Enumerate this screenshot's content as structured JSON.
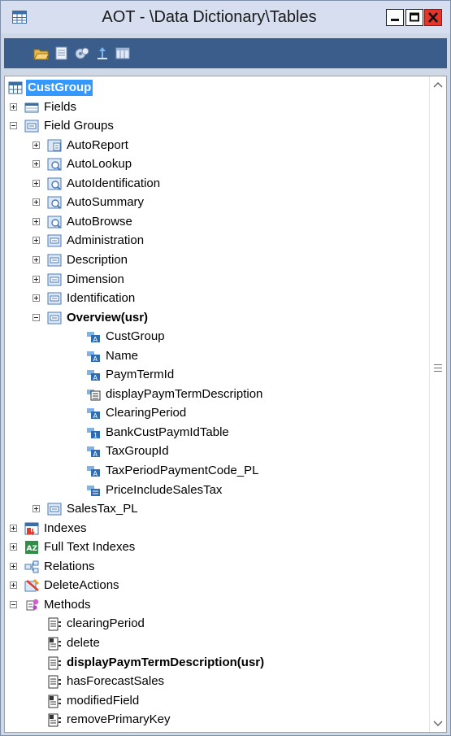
{
  "window": {
    "title": "AOT - \\Data Dictionary\\Tables",
    "icon": "table-grid-icon"
  },
  "toolbar": {
    "buttons": [
      {
        "icon": "open-folder-icon"
      },
      {
        "icon": "properties-icon"
      },
      {
        "icon": "compile-icon"
      },
      {
        "icon": "import-export-icon"
      },
      {
        "icon": "table-browser-icon"
      }
    ]
  },
  "tree": [
    {
      "label": "CustGroup",
      "icon": "table-icon",
      "level": 0,
      "expander": "none",
      "selected": true
    },
    {
      "label": "Fields",
      "icon": "fields-icon",
      "level": 1,
      "expander": "plus"
    },
    {
      "label": "Field Groups",
      "icon": "field-group-icon",
      "level": 1,
      "expander": "minus"
    },
    {
      "label": "AutoReport",
      "icon": "auto-report-icon",
      "level": 2,
      "expander": "plus"
    },
    {
      "label": "AutoLookup",
      "icon": "auto-group-icon",
      "level": 2,
      "expander": "plus"
    },
    {
      "label": "AutoIdentification",
      "icon": "auto-group-icon",
      "level": 2,
      "expander": "plus"
    },
    {
      "label": "AutoSummary",
      "icon": "auto-group-icon",
      "level": 2,
      "expander": "plus"
    },
    {
      "label": "AutoBrowse",
      "icon": "auto-group-icon",
      "level": 2,
      "expander": "plus"
    },
    {
      "label": "Administration",
      "icon": "field-group-icon",
      "level": 2,
      "expander": "plus"
    },
    {
      "label": "Description",
      "icon": "field-group-icon",
      "level": 2,
      "expander": "plus"
    },
    {
      "label": "Dimension",
      "icon": "field-group-icon",
      "level": 2,
      "expander": "plus"
    },
    {
      "label": "Identification",
      "icon": "field-group-icon",
      "level": 2,
      "expander": "plus"
    },
    {
      "label": "Overview(usr)",
      "icon": "field-group-icon",
      "level": 2,
      "expander": "minus",
      "bold": true
    },
    {
      "label": "CustGroup",
      "icon": "string-field-icon",
      "level": 3,
      "expander": "none"
    },
    {
      "label": "Name",
      "icon": "string-field-icon",
      "level": 3,
      "expander": "none"
    },
    {
      "label": "PaymTermId",
      "icon": "string-field-icon",
      "level": 3,
      "expander": "none"
    },
    {
      "label": "displayPaymTermDescription",
      "icon": "display-method-icon",
      "level": 3,
      "expander": "none"
    },
    {
      "label": "ClearingPeriod",
      "icon": "string-field-icon",
      "level": 3,
      "expander": "none"
    },
    {
      "label": "BankCustPaymIdTable",
      "icon": "int-field-icon",
      "level": 3,
      "expander": "none"
    },
    {
      "label": "TaxGroupId",
      "icon": "string-field-icon",
      "level": 3,
      "expander": "none"
    },
    {
      "label": "TaxPeriodPaymentCode_PL",
      "icon": "string-field-icon",
      "level": 3,
      "expander": "none"
    },
    {
      "label": "PriceIncludeSalesTax",
      "icon": "enum-field-icon",
      "level": 3,
      "expander": "none"
    },
    {
      "label": "SalesTax_PL",
      "icon": "field-group-icon",
      "level": 2,
      "expander": "plus"
    },
    {
      "label": "Indexes",
      "icon": "indexes-icon",
      "level": 1,
      "expander": "plus"
    },
    {
      "label": "Full Text Indexes",
      "icon": "full-text-index-icon",
      "level": 1,
      "expander": "plus"
    },
    {
      "label": "Relations",
      "icon": "relations-icon",
      "level": 1,
      "expander": "plus"
    },
    {
      "label": "DeleteActions",
      "icon": "delete-actions-icon",
      "level": 1,
      "expander": "plus"
    },
    {
      "label": "Methods",
      "icon": "methods-icon",
      "level": 1,
      "expander": "minus"
    },
    {
      "label": "clearingPeriod",
      "icon": "method-icon",
      "level": 2,
      "expander": "none"
    },
    {
      "label": "delete",
      "icon": "override-method-icon",
      "level": 2,
      "expander": "none"
    },
    {
      "label": "displayPaymTermDescription(usr)",
      "icon": "method-icon",
      "level": 2,
      "expander": "none",
      "bold": true
    },
    {
      "label": "hasForecastSales",
      "icon": "method-icon",
      "level": 2,
      "expander": "none"
    },
    {
      "label": "modifiedField",
      "icon": "override-method-icon",
      "level": 2,
      "expander": "none"
    },
    {
      "label": "removePrimaryKey",
      "icon": "override-method-icon",
      "level": 2,
      "expander": "none"
    }
  ]
}
